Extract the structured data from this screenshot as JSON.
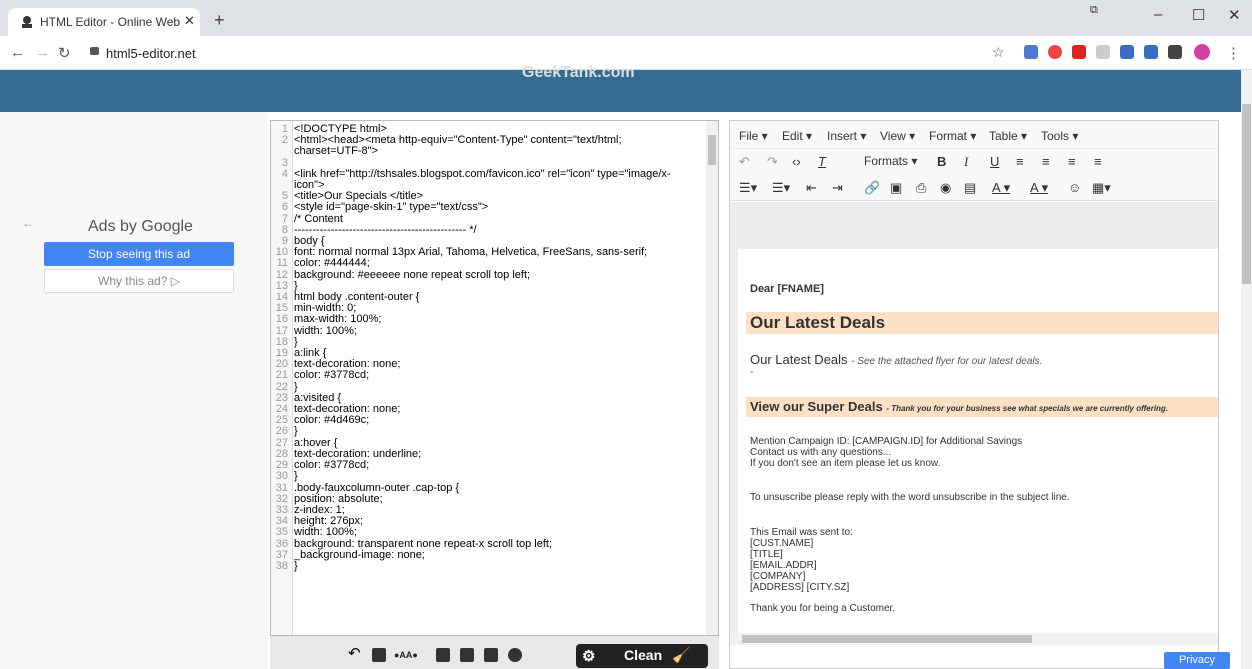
{
  "browser": {
    "tab_title": "HTML Editor - Online Web Conte",
    "tab_close": "✕",
    "new_tab": "+",
    "url": "html5-editor.net",
    "window_controls": {
      "minimize": "–",
      "maximize": "☐",
      "close": "✕"
    }
  },
  "banner": {
    "brand": "GeekTank.com"
  },
  "ad": {
    "back": "←",
    "title": "Ads by Google",
    "stop": "Stop seeing this ad",
    "why": "Why this ad? ▷"
  },
  "code_lines": [
    {
      "n": "1",
      "t": "<!DOCTYPE html>"
    },
    {
      "n": "2",
      "t": "<html><head><meta http-equiv=\"Content-Type\" content=\"text/html;"
    },
    {
      "n": "",
      "t": "charset=UTF-8\">"
    },
    {
      "n": "3",
      "t": ""
    },
    {
      "n": "4",
      "t": "<link href=\"http://tshsales.blogspot.com/favicon.ico\" rel=\"icon\" type=\"image/x-"
    },
    {
      "n": "",
      "t": "icon\">"
    },
    {
      "n": "5",
      "t": "<title>Our Specials </title>"
    },
    {
      "n": "6",
      "t": "<style id=\"page-skin-1\" type=\"text/css\">"
    },
    {
      "n": "7",
      "t": "/* Content"
    },
    {
      "n": "8",
      "t": "----------------------------------------------- */"
    },
    {
      "n": "9",
      "t": "body {"
    },
    {
      "n": "10",
      "t": "font: normal normal 13px Arial, Tahoma, Helvetica, FreeSans, sans-serif;"
    },
    {
      "n": "11",
      "t": "color: #444444;"
    },
    {
      "n": "12",
      "t": "background: #eeeeee none repeat scroll top left;"
    },
    {
      "n": "13",
      "t": "}"
    },
    {
      "n": "14",
      "t": "html body .content-outer {"
    },
    {
      "n": "15",
      "t": "min-width: 0;"
    },
    {
      "n": "16",
      "t": "max-width: 100%;"
    },
    {
      "n": "17",
      "t": "width: 100%;"
    },
    {
      "n": "18",
      "t": "}"
    },
    {
      "n": "19",
      "t": "a:link {"
    },
    {
      "n": "20",
      "t": "text-decoration: none;"
    },
    {
      "n": "21",
      "t": "color: #3778cd;"
    },
    {
      "n": "22",
      "t": "}"
    },
    {
      "n": "23",
      "t": "a:visited {"
    },
    {
      "n": "24",
      "t": "text-decoration: none;"
    },
    {
      "n": "25",
      "t": "color: #4d469c;"
    },
    {
      "n": "26",
      "t": "}"
    },
    {
      "n": "27",
      "t": "a:hover {"
    },
    {
      "n": "28",
      "t": "text-decoration: underline;"
    },
    {
      "n": "29",
      "t": "color: #3778cd;"
    },
    {
      "n": "30",
      "t": "}"
    },
    {
      "n": "31",
      "t": ".body-fauxcolumn-outer .cap-top {"
    },
    {
      "n": "32",
      "t": "position: absolute;"
    },
    {
      "n": "33",
      "t": "z-index: 1;"
    },
    {
      "n": "34",
      "t": "height: 276px;"
    },
    {
      "n": "35",
      "t": "width: 100%;"
    },
    {
      "n": "36",
      "t": "background: transparent none repeat-x scroll top left;"
    },
    {
      "n": "37",
      "t": "_background-image: none;"
    },
    {
      "n": "38",
      "t": "}"
    }
  ],
  "bottom_toolbar": {
    "clean": "Clean"
  },
  "wysiwyg": {
    "menus": [
      "File ▾",
      "Edit ▾",
      "Insert ▾",
      "View ▾",
      "Format ▾",
      "Table ▾",
      "Tools ▾"
    ],
    "formats": "Formats ▾",
    "doc": {
      "dear": "Dear [FNAME]",
      "h1": "Our Latest Deals",
      "sub_main": "Our Latest Deals",
      "sub_em": "- See the attached flyer for our latest deals.",
      "dash": "-",
      "h2_main": "View our Super Deals",
      "h2_em": "- Thank you for your business see what specials we are currently offering.",
      "p1": "Mention Campaign ID: [CAMPAIGN.ID] for Additional Savings",
      "p2": "Contact us with any questions...",
      "p3": "If you don't see an item please let us know.",
      "p4": "To unsuscribe please reply with the word unsubscribe in the subject line.",
      "p5": "This Email was sent to:",
      "p6": "[CUST.NAME]",
      "p7": "[TITLE]",
      "p8": "[EMAIL.ADDR]",
      "p9": "[COMPANY]",
      "p10": "[ADDRESS] [CITY.SZ]",
      "p11": "Thank you for being a Customer."
    }
  },
  "privacy": "Privacy"
}
